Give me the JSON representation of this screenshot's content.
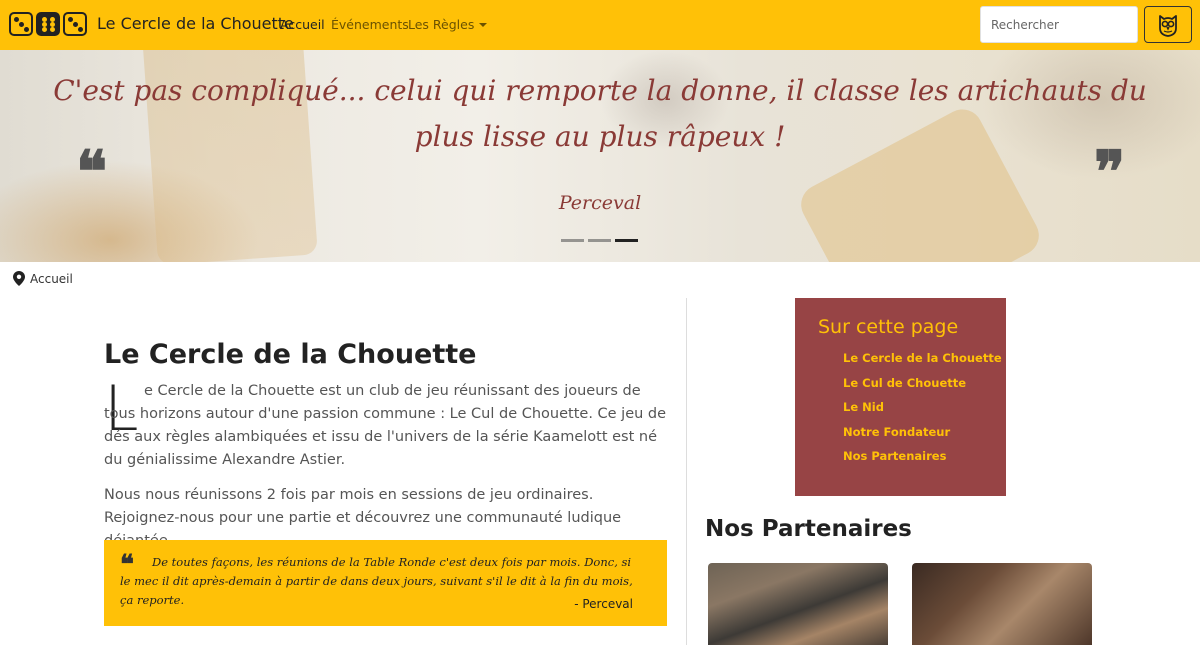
{
  "navbar": {
    "brand": "Le Cercle de la Chouette",
    "links": [
      {
        "label": "Accueil"
      },
      {
        "label": "Événements"
      },
      {
        "label": "Les Règles"
      }
    ],
    "search_placeholder": "Rechercher",
    "accent_color": "#ffc107"
  },
  "hero": {
    "quote": "C'est pas compliqué... celui qui remporte la donne, il classe les artichauts du plus lisse au plus râpeux !",
    "author": "Perceval",
    "open_quote": "❝",
    "close_quote": "❞",
    "slide_count": 3,
    "active_slide": 3,
    "text_color": "#8a3a36"
  },
  "breadcrumb": {
    "label": "Accueil"
  },
  "main": {
    "title": "Le Cercle de la Chouette",
    "drop_cap": "L",
    "intro_rest": "e Cercle de la Chouette est un club de jeu réunissant des joueurs de tous horizons autour d'une passion commune : Le Cul de Chouette. Ce jeu de dés aux règles alambiquées et issu de l'univers de la série Kaamelott est né du génialissime Alexandre Astier.",
    "paragraph2": "Nous nous réunissons 2 fois par mois en sessions de jeu ordinaires. Rejoignez-nous pour une partie et découvrez une communauté ludique déjantée.",
    "quote_box": {
      "mark": "❝",
      "text": "De toutes façons, les réunions de la Table Ronde c'est deux fois par mois. Donc, si le mec il dit après-demain à partir de dans deux jours, suivant s'il le dit à la fin du mois, ça reporte.",
      "author": "- Perceval"
    }
  },
  "sidebar": {
    "toc_title": "Sur cette page",
    "toc_items": [
      {
        "label": "Le Cercle de la Chouette"
      },
      {
        "label": "Le Cul de Chouette"
      },
      {
        "label": "Le Nid"
      },
      {
        "label": "Notre Fondateur"
      },
      {
        "label": "Nos Partenaires"
      }
    ],
    "toc_bg_color": "#974445",
    "partners_title": "Nos Partenaires"
  }
}
